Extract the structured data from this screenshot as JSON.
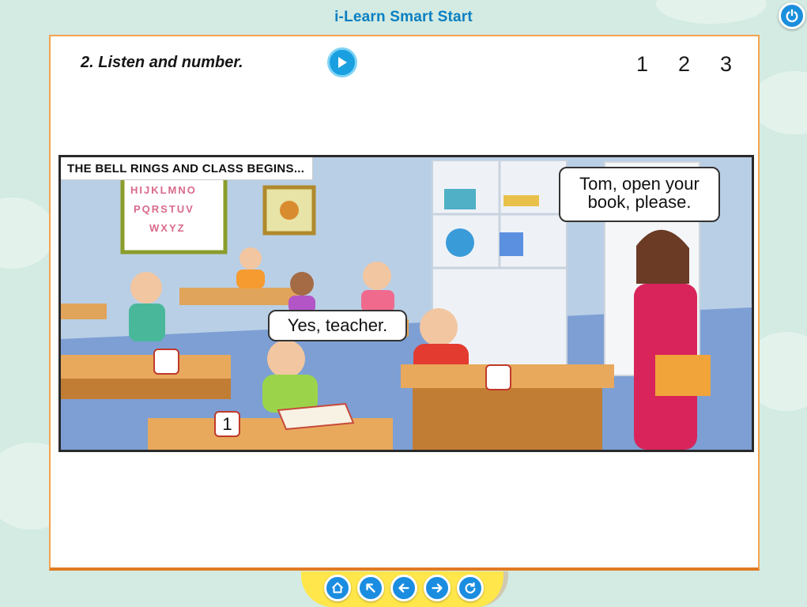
{
  "app": {
    "title": "i-Learn Smart Start"
  },
  "exercise": {
    "instruction": "2. Listen and number.",
    "pages": [
      "1",
      "2",
      "3"
    ]
  },
  "scene": {
    "caption": "THE BELL RINGS AND CLASS BEGINS...",
    "teacher_speech": "Tom, open your book, please.",
    "student_speech": "Yes, teacher.",
    "answer_boxes": [
      "",
      "1",
      ""
    ],
    "alphabet_row1": "HIJKLMNO",
    "alphabet_row2": "PQRSTUV",
    "alphabet_row3": "WXYZ"
  },
  "nav": {
    "buttons": [
      "home-icon",
      "arrow-up-left-icon",
      "arrow-left-icon",
      "arrow-right-icon",
      "refresh-icon"
    ]
  },
  "colors": {
    "accent": "#1a8de0",
    "panel_border": "#f3a34f",
    "nav_bar": "#ffe64a"
  }
}
